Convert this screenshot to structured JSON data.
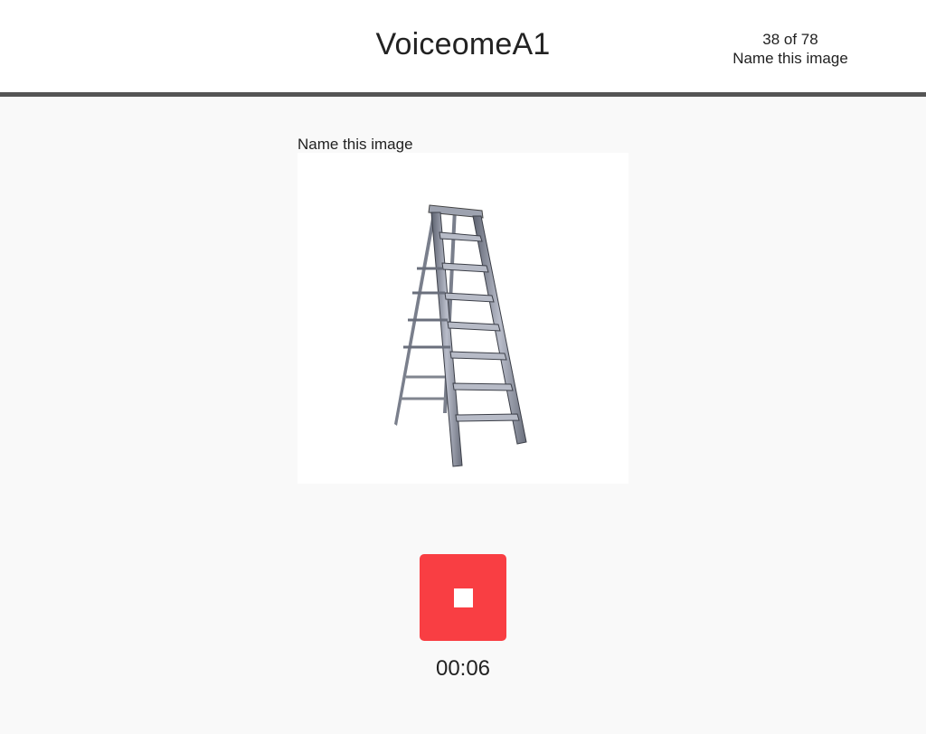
{
  "header": {
    "app_title": "VoiceomeA1",
    "progress": "38 of 78",
    "task_name": "Name this image"
  },
  "task": {
    "prompt": "Name this image",
    "image_icon": "ladder-image"
  },
  "recorder": {
    "button_icon": "stop-icon",
    "button_color": "#f93e43",
    "elapsed": "00:06"
  },
  "colors": {
    "header_border": "#555555",
    "page_background": "#f9f9f9"
  }
}
